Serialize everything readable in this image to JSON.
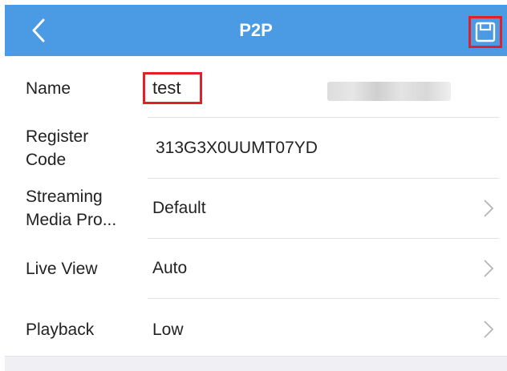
{
  "header": {
    "title": "P2P",
    "background_color": "#4a9ae4",
    "back_icon": "chevron-left-icon",
    "save_icon": "floppy-disk-icon"
  },
  "highlight_color": "#e0202a",
  "fields": {
    "name": {
      "label": "Name",
      "value": "test"
    },
    "register_code": {
      "label_line1": "Register",
      "label_line2": "Code",
      "value": "313G3X0UUMT07YD"
    },
    "streaming": {
      "label_line1": "Streaming",
      "label_line2": "Media Pro...",
      "value": "Default"
    },
    "live_view": {
      "label": "Live View",
      "value": "Auto"
    },
    "playback": {
      "label": "Playback",
      "value": "Low"
    }
  }
}
